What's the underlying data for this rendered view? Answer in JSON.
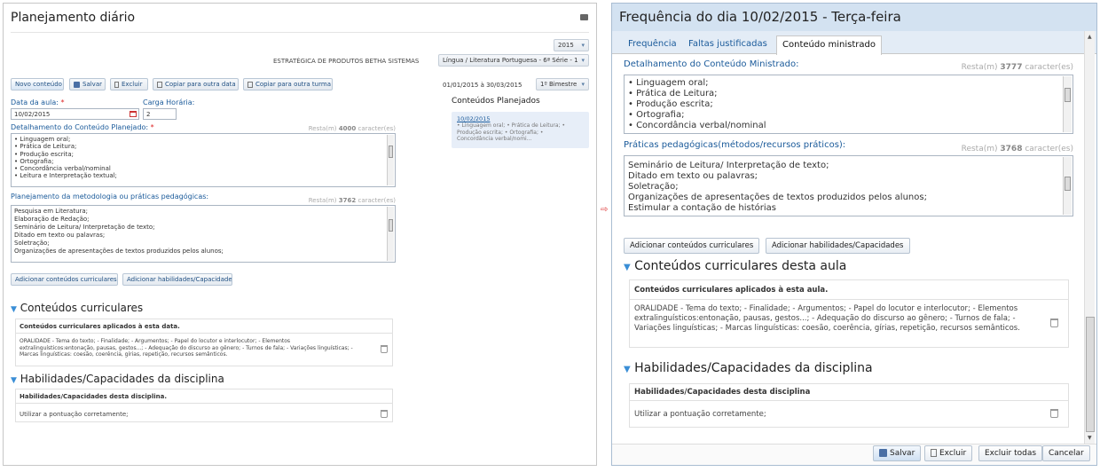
{
  "left": {
    "title": "Planejamento diário",
    "year": "2015",
    "org": "ESTRATÉGICA DE PRODUTOS BETHA SISTEMAS",
    "discipline": "Língua / Literatura Portuguesa - 6ª Série - 1",
    "toolbar": {
      "new_label": "Novo conteúdo",
      "save_label": "Salvar",
      "delete_label": "Excluir",
      "copy_date_label": "Copiar para outra data",
      "copy_class_label": "Copiar para outra turma"
    },
    "period": "01/01/2015 à 30/03/2015",
    "bimester": "1º Bimestre",
    "date_label": "Data da aula:",
    "date_req": "*",
    "date_value": "10/02/2015",
    "load_label": "Carga Horária:",
    "load_value": "2",
    "detail": {
      "label": "Detalhamento do Conteúdo Planejado:",
      "req": "*",
      "count_prefix": "Resta(m)",
      "count_num": "4000",
      "count_suffix": "caracter(es)",
      "lines": [
        "• Linguagem oral;",
        "• Prática de Leitura;",
        "• Produção escrita;",
        "• Ortografia;",
        "• Concordância verbal/nominal",
        "• Leitura e Interpretação textual;"
      ]
    },
    "method": {
      "label": "Planejamento da metodologia ou práticas pedagógicas:",
      "count_prefix": "Resta(m)",
      "count_num": "3762",
      "count_suffix": "caracter(es)",
      "lines": [
        "Pesquisa em Literatura;",
        "Elaboração de Redação;",
        "Seminário de Leitura/ Interpretação de texto;",
        "Ditado em texto ou palavras;",
        "Soletração;",
        "Organizações de apresentações de textos produzidos pelos alunos;"
      ]
    },
    "add_curr_label": "Adicionar conteúdos curriculares",
    "add_skill_label": "Adicionar habilidades/Capacidades",
    "curr_section": "Conteúdos curriculares",
    "curr_header": "Conteúdos curriculares aplicados à esta data.",
    "curr_text": "ORALIDADE - Tema do texto; - Finalidade; - Argumentos; - Papel do locutor e interlocutor; - Elementos extralinguísticos:entonação, pausas, gestos...; - Adequação do discurso ao gênero; - Turnos de fala; - Variações linguísticas; - Marcas linguísticas: coesão, coerência, gírias, repetição, recursos semânticos.",
    "skill_section": "Habilidades/Capacidades da disciplina",
    "skill_header": "Habilidades/Capacidades desta disciplina.",
    "skill_text": "Utilizar a pontuação corretamente;",
    "planned_title": "Conteúdos Planejados",
    "planned_date": "10/02/2015",
    "planned_text": "• Linguagem oral; • Prática de Leitura; • Produção escrita; • Ortografia; • Concordância verbal/nomi..."
  },
  "right": {
    "title": "Frequência do dia 10/02/2015 - Terça-feira",
    "tabs": [
      "Frequência",
      "Faltas justificadas",
      "Conteúdo ministrado"
    ],
    "detail": {
      "label": "Detalhamento do Conteúdo Ministrado:",
      "count_prefix": "Resta(m)",
      "count_num": "3777",
      "count_suffix": "caracter(es)",
      "lines": [
        "• Linguagem oral;",
        "• Prática de Leitura;",
        "• Produção escrita;",
        "• Ortografia;",
        "• Concordância verbal/nominal"
      ]
    },
    "practices": {
      "label": "Práticas pedagógicas(métodos/recursos práticos):",
      "count_prefix": "Resta(m)",
      "count_num": "3768",
      "count_suffix": "caracter(es)",
      "lines": [
        "Seminário de Leitura/ Interpretação de texto;",
        "Ditado em texto ou palavras;",
        "Soletração;",
        "Organizações de apresentações de textos produzidos pelos alunos;",
        "Estimular a contação de histórias"
      ]
    },
    "add_curr_label": "Adicionar conteúdos curriculares",
    "add_skill_label": "Adicionar habilidades/Capacidades",
    "curr_section": "Conteúdos curriculares desta aula",
    "curr_header": "Conteúdos curriculares aplicados à esta aula.",
    "curr_text": "ORALIDADE - Tema do texto; - Finalidade; - Argumentos; - Papel do locutor e interlocutor; - Elementos extralinguísticos:entonação, pausas, gestos...; - Adequação do discurso ao gênero; - Turnos de fala; - Variações linguísticas; - Marcas linguísticas: coesão, coerência, gírias, repetição, recursos semânticos.",
    "skill_section": "Habilidades/Capacidades da disciplina",
    "skill_header": "Habilidades/Capacidades desta disciplina",
    "skill_text": "Utilizar a pontuação corretamente;",
    "footer": {
      "save_label": "Salvar",
      "delete_label": "Excluir",
      "delete_all_label": "Excluir todas",
      "cancel_label": "Cancelar"
    }
  },
  "colors": {
    "accent": "#1a5a9a",
    "title_bar": "#d3e2f1",
    "required": "#dd2222"
  },
  "icons": [
    "printer-icon",
    "floppy-disk-icon",
    "trash-icon",
    "copy-icon",
    "calendar-icon",
    "arrow-right-icon"
  ]
}
